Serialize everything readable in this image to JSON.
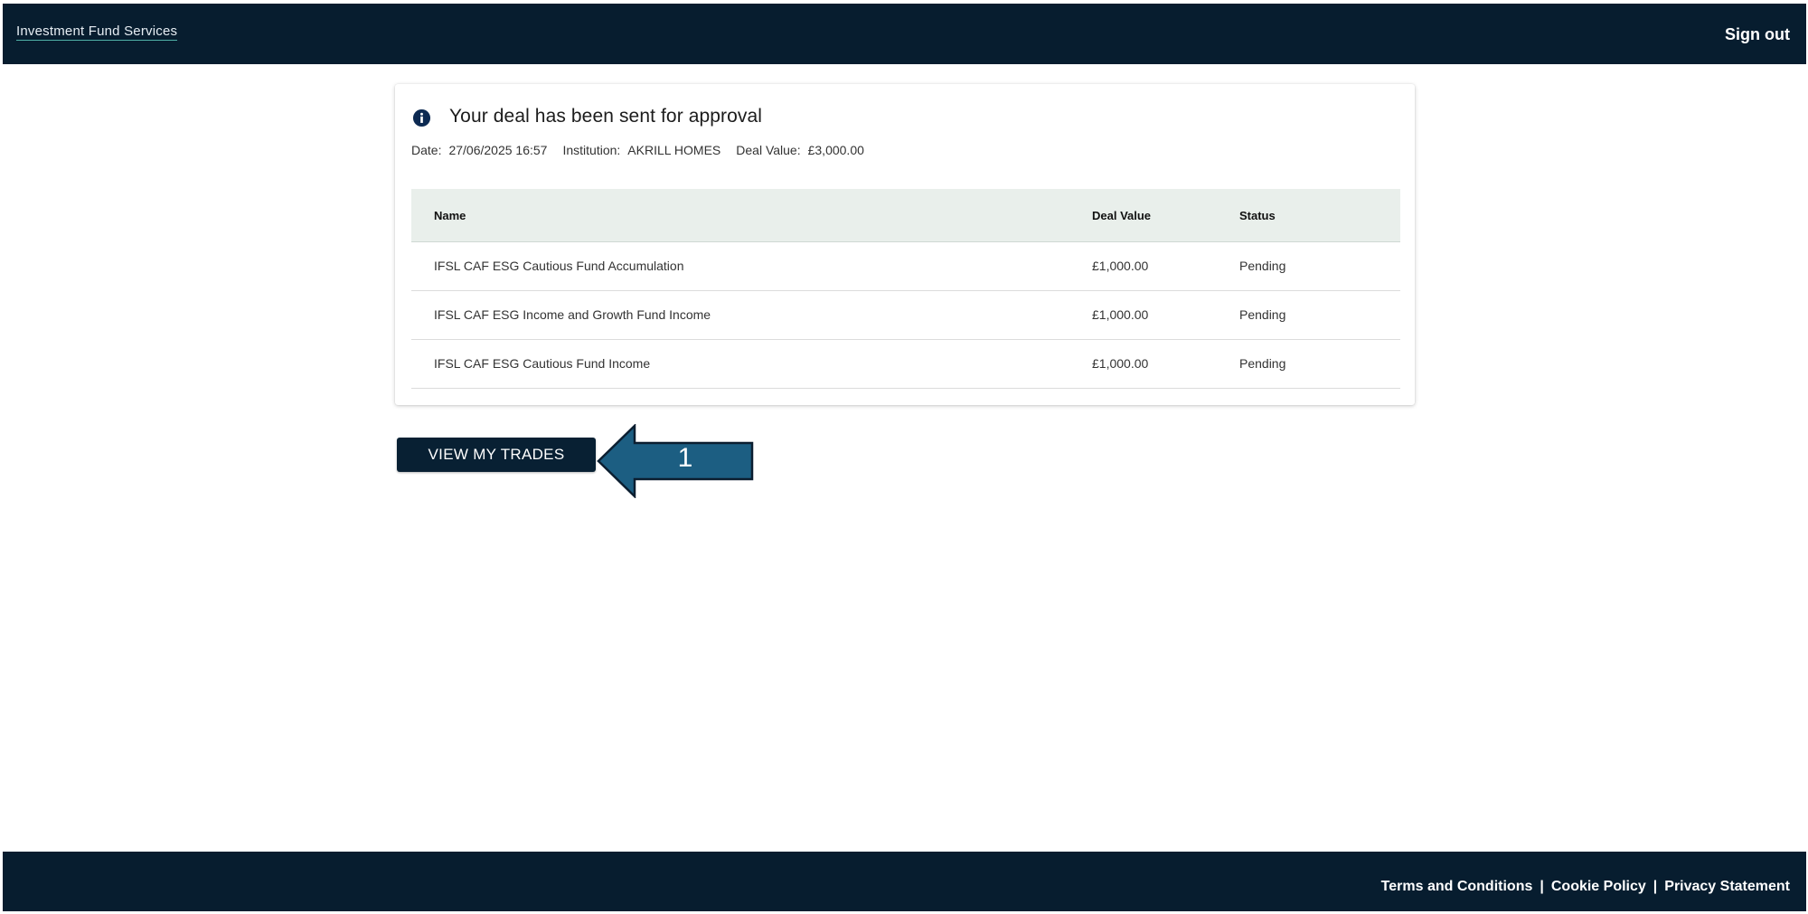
{
  "header": {
    "brand": "Investment Fund Services",
    "sign_out": "Sign out"
  },
  "confirmation": {
    "title": "Your deal has been sent for approval",
    "date_label": "Date:",
    "date_value": "27/06/2025 16:57",
    "institution_label": "Institution:",
    "institution_value": "AKRILL HOMES",
    "deal_value_label": "Deal Value:",
    "deal_value_value": "£3,000.00"
  },
  "table": {
    "columns": [
      "Name",
      "Deal Value",
      "Status"
    ],
    "rows": [
      {
        "name": "IFSL CAF ESG Cautious Fund Accumulation",
        "deal_value": "£1,000.00",
        "status": "Pending"
      },
      {
        "name": "IFSL CAF ESG Income and Growth Fund Income",
        "deal_value": "£1,000.00",
        "status": "Pending"
      },
      {
        "name": "IFSL CAF ESG Cautious Fund Income",
        "deal_value": "£1,000.00",
        "status": "Pending"
      }
    ]
  },
  "actions": {
    "view_trades": "VIEW MY TRADES"
  },
  "callout": {
    "number": "1",
    "color": "#1c5e82"
  },
  "footer": {
    "terms": "Terms and Conditions",
    "separator": "|",
    "cookie": "Cookie Policy",
    "privacy": "Privacy Statement"
  },
  "icons": {
    "info": "info-icon",
    "callout_arrow": "arrow-left-icon"
  }
}
